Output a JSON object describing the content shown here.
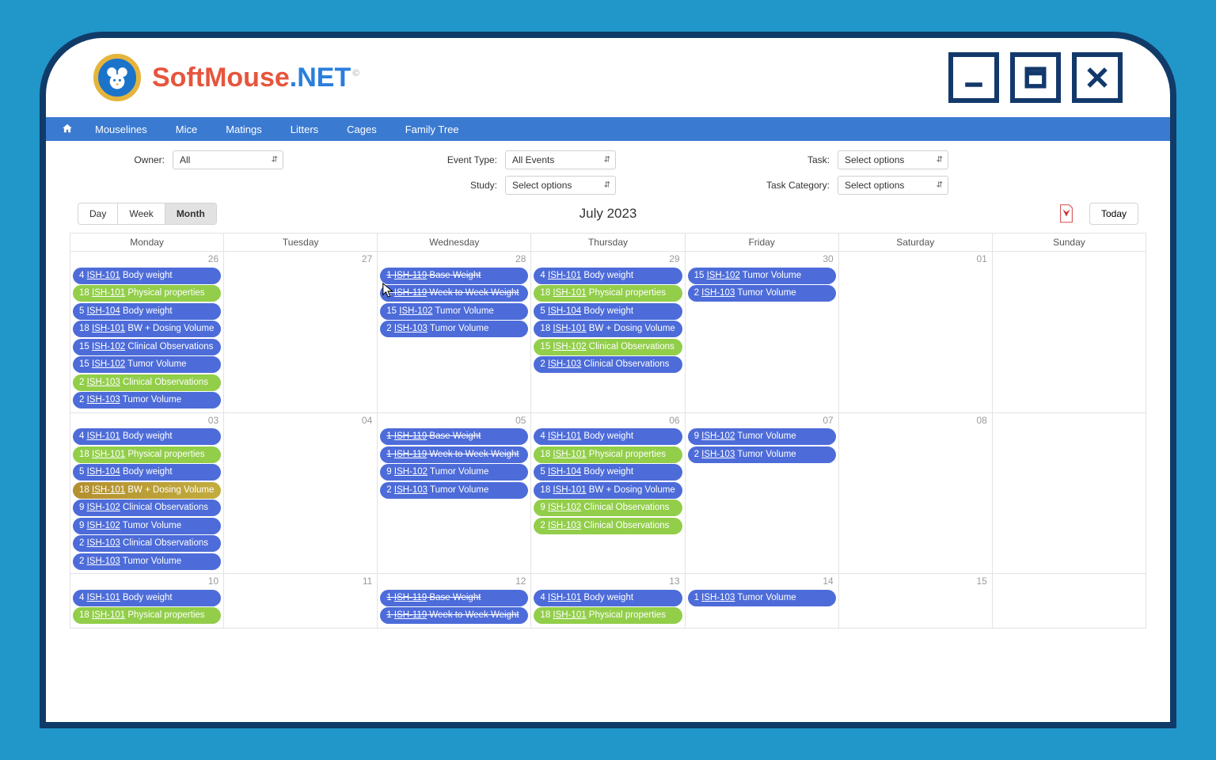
{
  "app": {
    "logo": {
      "soft": "Soft",
      "mouse": "Mouse",
      "net": ".NET",
      "trade": "©"
    }
  },
  "nav": [
    "Mouselines",
    "Mice",
    "Matings",
    "Litters",
    "Cages",
    "Family Tree"
  ],
  "filters": {
    "owner_label": "Owner:",
    "owner_value": "All",
    "eventtype_label": "Event Type:",
    "eventtype_value": "All Events",
    "study_label": "Study:",
    "study_value": "Select options",
    "task_label": "Task:",
    "task_value": "Select options",
    "taskcat_label": "Task Category:",
    "taskcat_value": "Select options"
  },
  "views": {
    "day": "Day",
    "week": "Week",
    "month": "Month",
    "active": "month"
  },
  "calendar_title": "July 2023",
  "today_label": "Today",
  "day_headers": [
    "Monday",
    "Tuesday",
    "Wednesday",
    "Thursday",
    "Friday",
    "Saturday",
    "Sunday"
  ],
  "weeks": [
    {
      "days": [
        {
          "num": "26",
          "events": [
            {
              "c": "blue",
              "n": "4",
              "code": "ISH-101",
              "t": "Body weight"
            },
            {
              "c": "green",
              "n": "18",
              "code": "ISH-101",
              "t": "Physical properties"
            },
            {
              "c": "blue",
              "n": "5",
              "code": "ISH-104",
              "t": "Body weight"
            },
            {
              "c": "blue",
              "n": "18",
              "code": "ISH-101",
              "t": "BW + Dosing Volume"
            },
            {
              "c": "blue",
              "n": "15",
              "code": "ISH-102",
              "t": "Clinical Observations"
            },
            {
              "c": "blue",
              "n": "15",
              "code": "ISH-102",
              "t": "Tumor Volume"
            },
            {
              "c": "green",
              "n": "2",
              "code": "ISH-103",
              "t": "Clinical Observations"
            },
            {
              "c": "blue",
              "n": "2",
              "code": "ISH-103",
              "t": "Tumor Volume"
            }
          ]
        },
        {
          "num": "27",
          "events": []
        },
        {
          "num": "28",
          "events": [
            {
              "c": "blue",
              "n": "1",
              "code": "ISH-119",
              "t": "Base Weight",
              "strike": true
            },
            {
              "c": "blue",
              "n": "1",
              "code": "ISH-119",
              "t": "Week to Week Weight",
              "strike": true
            },
            {
              "c": "blue",
              "n": "15",
              "code": "ISH-102",
              "t": "Tumor Volume"
            },
            {
              "c": "blue",
              "n": "2",
              "code": "ISH-103",
              "t": "Tumor Volume"
            }
          ]
        },
        {
          "num": "29",
          "events": [
            {
              "c": "blue",
              "n": "4",
              "code": "ISH-101",
              "t": "Body weight"
            },
            {
              "c": "green",
              "n": "18",
              "code": "ISH-101",
              "t": "Physical properties"
            },
            {
              "c": "blue",
              "n": "5",
              "code": "ISH-104",
              "t": "Body weight"
            },
            {
              "c": "blue",
              "n": "18",
              "code": "ISH-101",
              "t": "BW + Dosing Volume"
            },
            {
              "c": "green",
              "n": "15",
              "code": "ISH-102",
              "t": "Clinical Observations"
            },
            {
              "c": "blue",
              "n": "2",
              "code": "ISH-103",
              "t": "Clinical Observations"
            }
          ]
        },
        {
          "num": "30",
          "events": [
            {
              "c": "blue",
              "n": "15",
              "code": "ISH-102",
              "t": "Tumor Volume"
            },
            {
              "c": "blue",
              "n": "2",
              "code": "ISH-103",
              "t": "Tumor Volume"
            }
          ]
        },
        {
          "num": "01",
          "events": []
        },
        {
          "num": "",
          "events": []
        }
      ]
    },
    {
      "days": [
        {
          "num": "03",
          "events": [
            {
              "c": "blue",
              "n": "4",
              "code": "ISH-101",
              "t": "Body weight"
            },
            {
              "c": "green",
              "n": "18",
              "code": "ISH-101",
              "t": "Physical properties"
            },
            {
              "c": "blue",
              "n": "5",
              "code": "ISH-104",
              "t": "Body weight"
            },
            {
              "c": "amber",
              "n": "18",
              "code": "ISH-101",
              "t": "BW + Dosing Volume"
            },
            {
              "c": "blue",
              "n": "9",
              "code": "ISH-102",
              "t": "Clinical Observations"
            },
            {
              "c": "blue",
              "n": "9",
              "code": "ISH-102",
              "t": "Tumor Volume"
            },
            {
              "c": "blue",
              "n": "2",
              "code": "ISH-103",
              "t": "Clinical Observations"
            },
            {
              "c": "blue",
              "n": "2",
              "code": "ISH-103",
              "t": "Tumor Volume"
            }
          ]
        },
        {
          "num": "04",
          "events": []
        },
        {
          "num": "05",
          "events": [
            {
              "c": "blue",
              "n": "1",
              "code": "ISH-119",
              "t": "Base Weight",
              "strike": true
            },
            {
              "c": "blue",
              "n": "1",
              "code": "ISH-119",
              "t": "Week to Week Weight",
              "strike": true
            },
            {
              "c": "blue",
              "n": "9",
              "code": "ISH-102",
              "t": "Tumor Volume"
            },
            {
              "c": "blue",
              "n": "2",
              "code": "ISH-103",
              "t": "Tumor Volume"
            }
          ]
        },
        {
          "num": "06",
          "events": [
            {
              "c": "blue",
              "n": "4",
              "code": "ISH-101",
              "t": "Body weight"
            },
            {
              "c": "green",
              "n": "18",
              "code": "ISH-101",
              "t": "Physical properties"
            },
            {
              "c": "blue",
              "n": "5",
              "code": "ISH-104",
              "t": "Body weight"
            },
            {
              "c": "blue",
              "n": "18",
              "code": "ISH-101",
              "t": "BW + Dosing Volume"
            },
            {
              "c": "green",
              "n": "9",
              "code": "ISH-102",
              "t": "Clinical Observations"
            },
            {
              "c": "green",
              "n": "2",
              "code": "ISH-103",
              "t": "Clinical Observations"
            }
          ]
        },
        {
          "num": "07",
          "events": [
            {
              "c": "blue",
              "n": "9",
              "code": "ISH-102",
              "t": "Tumor Volume"
            },
            {
              "c": "blue",
              "n": "2",
              "code": "ISH-103",
              "t": "Tumor Volume"
            }
          ]
        },
        {
          "num": "08",
          "events": []
        },
        {
          "num": "",
          "events": []
        }
      ]
    },
    {
      "days": [
        {
          "num": "10",
          "events": [
            {
              "c": "blue",
              "n": "4",
              "code": "ISH-101",
              "t": "Body weight"
            },
            {
              "c": "green",
              "n": "18",
              "code": "ISH-101",
              "t": "Physical properties"
            }
          ]
        },
        {
          "num": "11",
          "events": []
        },
        {
          "num": "12",
          "events": [
            {
              "c": "blue",
              "n": "1",
              "code": "ISH-119",
              "t": "Base Weight",
              "strike": true
            },
            {
              "c": "blue",
              "n": "1",
              "code": "ISH-119",
              "t": "Week to Week Weight",
              "strike": true
            }
          ]
        },
        {
          "num": "13",
          "events": [
            {
              "c": "blue",
              "n": "4",
              "code": "ISH-101",
              "t": "Body weight"
            },
            {
              "c": "green",
              "n": "18",
              "code": "ISH-101",
              "t": "Physical properties"
            }
          ]
        },
        {
          "num": "14",
          "events": [
            {
              "c": "blue",
              "n": "1",
              "code": "ISH-103",
              "t": "Tumor Volume"
            }
          ]
        },
        {
          "num": "15",
          "events": []
        },
        {
          "num": "",
          "events": []
        }
      ]
    }
  ]
}
